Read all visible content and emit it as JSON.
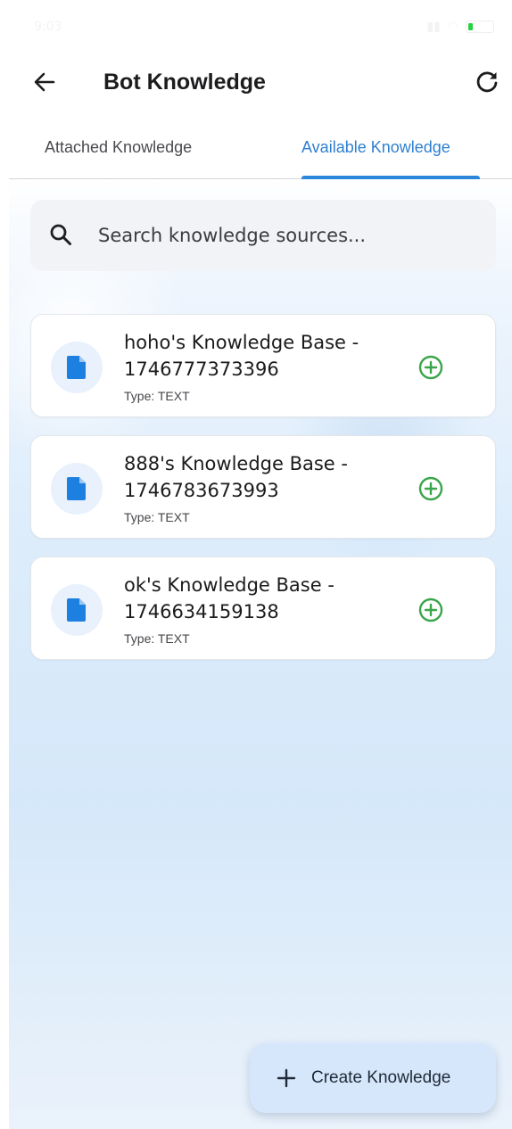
{
  "status_bar": {
    "time": "9:03"
  },
  "header": {
    "title": "Bot Knowledge",
    "back_icon": "arrow-left-icon",
    "refresh_icon": "refresh-icon"
  },
  "tabs": [
    {
      "label": "Attached Knowledge",
      "active": false
    },
    {
      "label": "Available Knowledge",
      "active": true
    }
  ],
  "search": {
    "placeholder": "Search knowledge sources...",
    "value": "",
    "icon": "search-icon"
  },
  "knowledge_items": [
    {
      "name": "hoho's Knowledge Base - 1746777373396",
      "type": "Type: TEXT",
      "icon": "document-icon",
      "action_icon": "add-circle-icon"
    },
    {
      "name": "888's Knowledge Base - 1746783673993",
      "type": "Type: TEXT",
      "icon": "document-icon",
      "action_icon": "add-circle-icon"
    },
    {
      "name": "ok's Knowledge Base - 1746634159138",
      "type": "Type: TEXT",
      "icon": "document-icon",
      "action_icon": "add-circle-icon"
    }
  ],
  "fab": {
    "label": "Create Knowledge",
    "icon": "plus-icon"
  },
  "colors": {
    "accent": "#2a87dc",
    "doc_icon": "#1d7fe0",
    "add_icon": "#3aa54a",
    "fab_bg": "#d6e6fb"
  }
}
